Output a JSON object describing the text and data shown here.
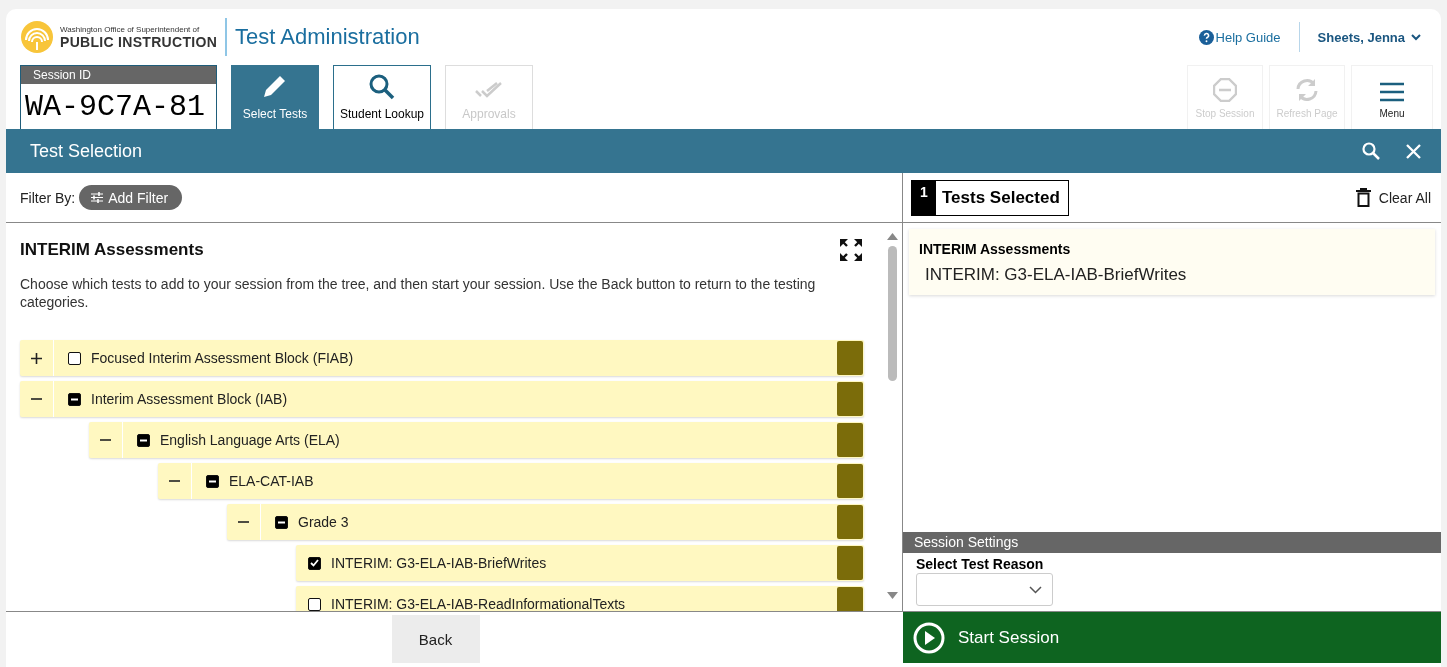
{
  "header": {
    "org_line1": "Washington Office of Superintendent of",
    "org_line2": "PUBLIC INSTRUCTION",
    "app_title": "Test Administration",
    "help": "Help Guide",
    "user": "Sheets, Jenna"
  },
  "session": {
    "label": "Session ID",
    "id": "WA-9C7A-81"
  },
  "tabs": [
    {
      "label": "Select Tests",
      "selected": true,
      "disabled": false
    },
    {
      "label": "Student Lookup",
      "selected": false,
      "disabled": false
    },
    {
      "label": "Approvals",
      "selected": false,
      "disabled": true
    }
  ],
  "actions": [
    {
      "label": "Stop Session",
      "disabled": true
    },
    {
      "label": "Refresh Page",
      "disabled": true
    },
    {
      "label": "Menu",
      "disabled": false
    }
  ],
  "title_bar": {
    "title": "Test Selection"
  },
  "filter": {
    "label": "Filter By:",
    "button": "Add Filter"
  },
  "tree_panel": {
    "heading": "INTERIM Assessments",
    "instructions": "Choose which tests to add to your session from the tree, and then start your session. Use the Back button to return to the testing categories.",
    "tree": [
      {
        "kind": "group",
        "label": "Focused Interim Assessment Block (FIAB)",
        "expanded": false,
        "checked": false,
        "partial": false
      },
      {
        "kind": "group",
        "label": "Interim Assessment Block (IAB)",
        "expanded": true,
        "checked": false,
        "partial": true,
        "children": [
          {
            "kind": "group",
            "label": "English Language Arts (ELA)",
            "expanded": true,
            "checked": false,
            "partial": true,
            "children": [
              {
                "kind": "group",
                "label": "ELA-CAT-IAB",
                "expanded": true,
                "checked": false,
                "partial": true,
                "children": [
                  {
                    "kind": "group",
                    "label": "Grade 3",
                    "expanded": true,
                    "checked": false,
                    "partial": true,
                    "children": [
                      {
                        "kind": "test",
                        "label": "INTERIM: G3-ELA-IAB-BriefWrites",
                        "checked": true
                      },
                      {
                        "kind": "test",
                        "label": "INTERIM: G3-ELA-IAB-ReadInformationalTexts",
                        "checked": false
                      }
                    ]
                  }
                ]
              }
            ]
          }
        ]
      }
    ]
  },
  "selected_panel": {
    "count": "1",
    "title": "Tests Selected",
    "clear": "Clear All",
    "group": "INTERIM Assessments",
    "items": [
      "INTERIM: G3-ELA-IAB-BriefWrites"
    ]
  },
  "session_settings": {
    "title": "Session Settings",
    "reason_label": "Select Test Reason"
  },
  "footer": {
    "back": "Back",
    "start": "Start Session"
  }
}
